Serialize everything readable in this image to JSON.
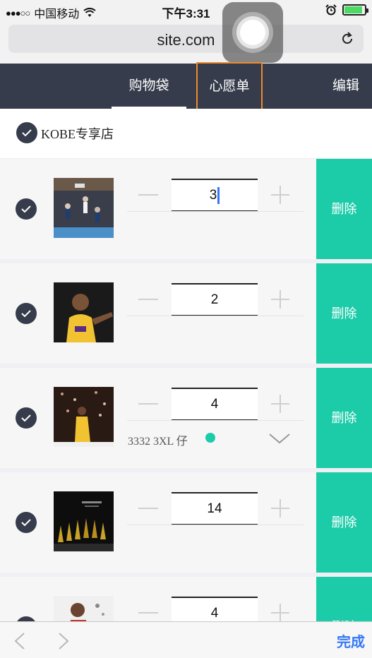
{
  "status_bar": {
    "carrier": "中国移动",
    "time": "下午3:31",
    "battery_level": 0.9
  },
  "browser": {
    "url": "site.com"
  },
  "nav": {
    "tabs": [
      "购物袋",
      "心愿单"
    ],
    "edit_label": "编辑"
  },
  "shop": {
    "name": "KOBE专享店"
  },
  "items": [
    {
      "quantity": "3",
      "delete_label": "删除"
    },
    {
      "quantity": "2",
      "delete_label": "删除"
    },
    {
      "quantity": "4",
      "delete_label": "删除",
      "spec": "3332 3XL 仔"
    },
    {
      "quantity": "14",
      "delete_label": "删除"
    },
    {
      "quantity": "4",
      "delete_label": "删除"
    }
  ],
  "toolbar": {
    "done_label": "完成"
  },
  "colors": {
    "nav_bg": "#363c4b",
    "accent": "#1ccca9",
    "highlight": "#f08a2c",
    "link": "#3478f6"
  }
}
